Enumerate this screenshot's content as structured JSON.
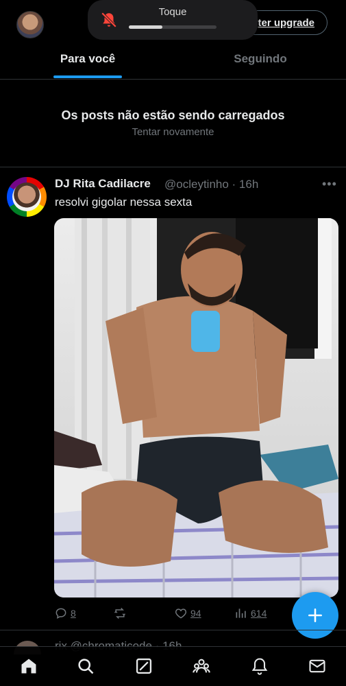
{
  "header": {
    "upgrade_label": "ter upgrade",
    "tabs": [
      {
        "label": "Para você",
        "active": true
      },
      {
        "label": "Seguindo",
        "active": false
      }
    ]
  },
  "toast": {
    "title": "Toque",
    "icon": "bell-slash-icon",
    "level": 0.38,
    "icon_color": "#ff453a"
  },
  "feed_error": {
    "title": "Os posts não estão sendo carregados",
    "retry_label": "Tentar novamente"
  },
  "post": {
    "author": "DJ Rita Cadilacre",
    "meta": "@ocleytinho · 16h",
    "text": "resolvi gigolar nessa sexta",
    "more_icon": "more-dots-icon",
    "actions": [
      {
        "icon": "reply-icon",
        "count": "8"
      },
      {
        "icon": "retweet-icon",
        "count": ""
      },
      {
        "icon": "like-icon",
        "count": "94"
      },
      {
        "icon": "views-icon",
        "count": "614"
      }
    ]
  },
  "next_post_peek": "rix @chromaticode · 16h",
  "compose_icon": "plus-icon",
  "bottom_nav": [
    {
      "icon": "home-icon",
      "active": true
    },
    {
      "icon": "search-icon",
      "active": false
    },
    {
      "icon": "grok-icon",
      "active": false
    },
    {
      "icon": "communities-icon",
      "active": false
    },
    {
      "icon": "notifications-icon",
      "active": false
    },
    {
      "icon": "messages-icon",
      "active": false
    }
  ],
  "colors": {
    "accent": "#1d9bf0",
    "background": "#000000",
    "text_primary": "#e7e9ea",
    "text_secondary": "#71767b",
    "divider": "#2f3336"
  }
}
